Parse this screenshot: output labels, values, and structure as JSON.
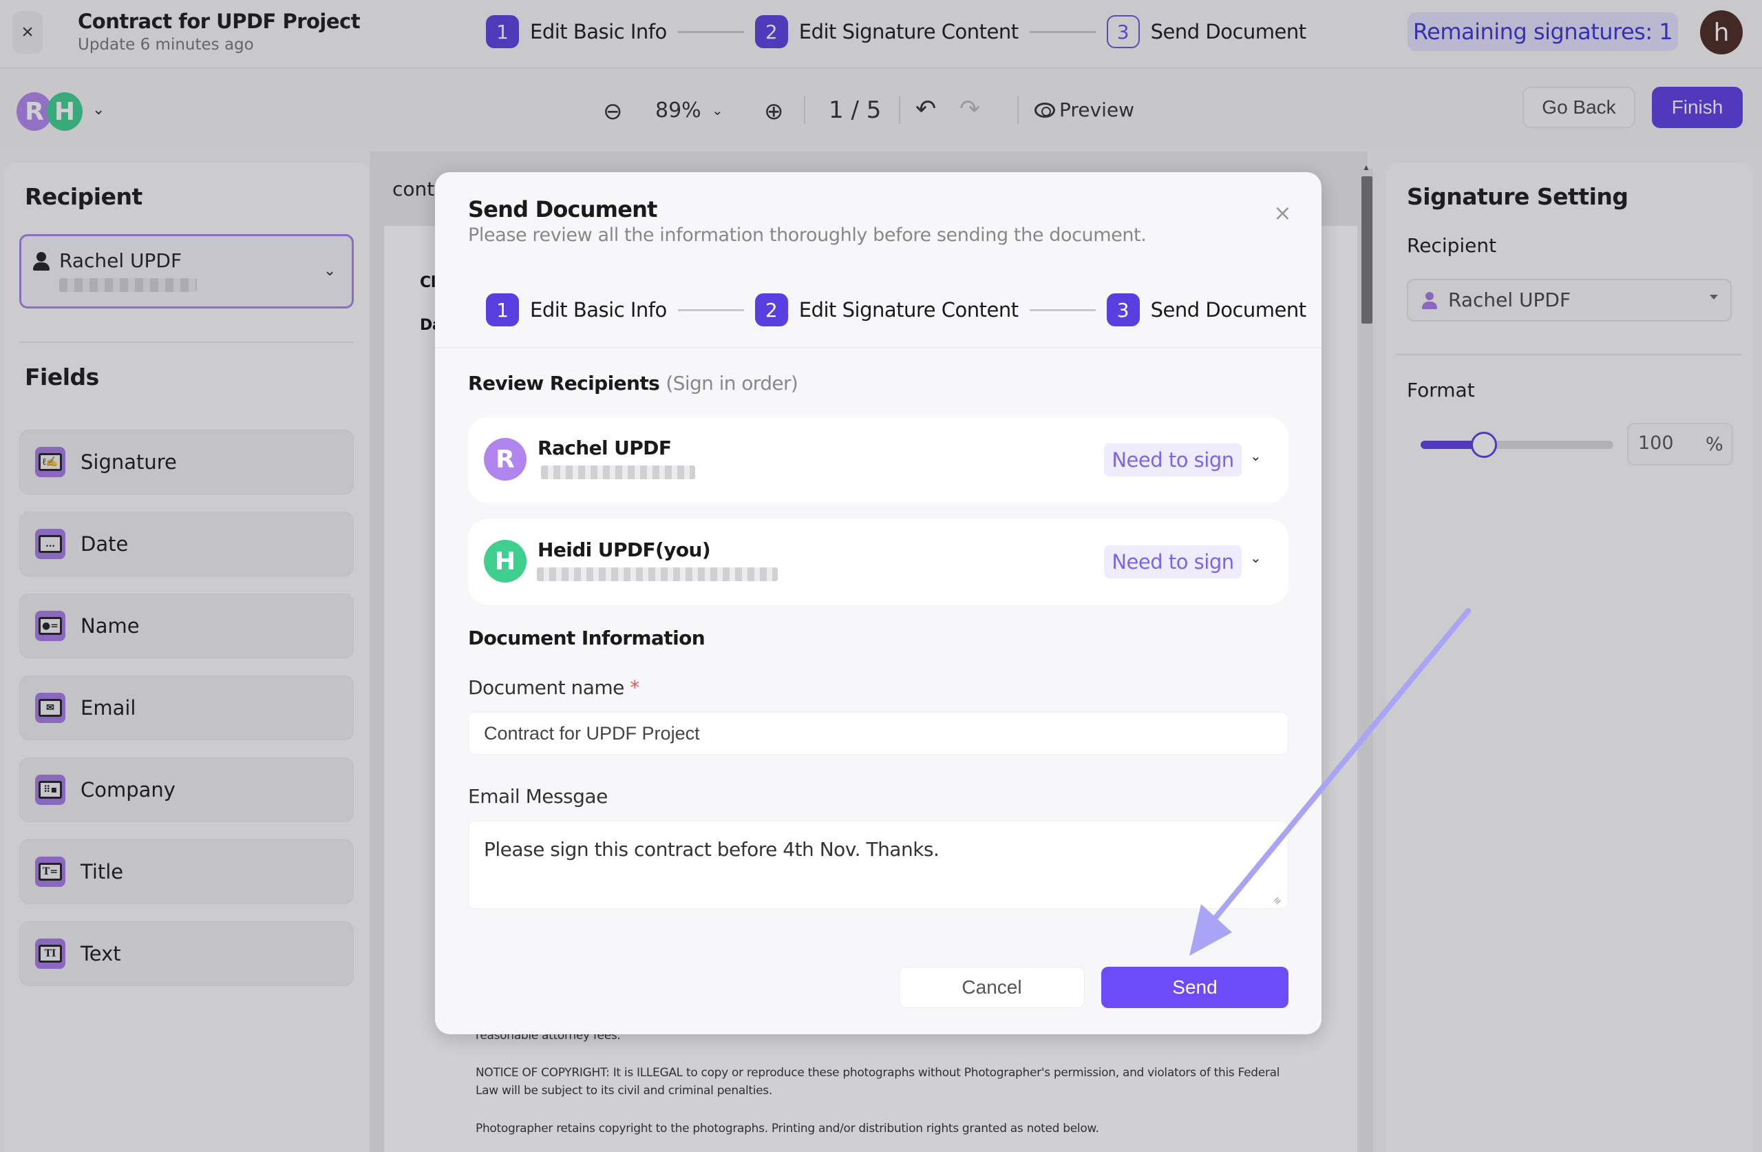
{
  "header": {
    "close_icon": "×",
    "title": "Contract for UPDF Project",
    "subtitle": "Update 6 minutes ago",
    "steps": [
      {
        "num": "1",
        "label": "Edit Basic Info",
        "state": "done"
      },
      {
        "num": "2",
        "label": "Edit Signature Content",
        "state": "done"
      },
      {
        "num": "3",
        "label": "Send Document",
        "state": "current"
      }
    ],
    "remaining_signatures": "Remaining signatures: 1",
    "user_initial": "h"
  },
  "toolbar": {
    "avatars": [
      "R",
      "H"
    ],
    "zoom_level": "89%",
    "page_indicator": "1 / 5",
    "preview_label": "Preview",
    "go_back_label": "Go Back",
    "finish_label": "Finish"
  },
  "left_panel": {
    "recipient_heading": "Recipient",
    "selected_recipient": "Rachel UPDF",
    "fields_heading": "Fields",
    "fields": [
      {
        "label": "Signature",
        "icon": "signature-icon"
      },
      {
        "label": "Date",
        "icon": "calendar-icon"
      },
      {
        "label": "Name",
        "icon": "id-card-icon"
      },
      {
        "label": "Email",
        "icon": "envelope-icon"
      },
      {
        "label": "Company",
        "icon": "building-icon"
      },
      {
        "label": "Title",
        "icon": "title-icon"
      },
      {
        "label": "Text",
        "icon": "text-icon"
      }
    ]
  },
  "document": {
    "name_label_partial": "contr",
    "visible_text": [
      "reasonable attorney fees.",
      "NOTICE OF COPYRIGHT: It is ILLEGAL to copy or reproduce these photographs without Photographer's permission, and violators of this Federal",
      "Law will be subject to its civil and criminal penalties.",
      "Photographer retains copyright to the photographs. Printing and/or distribution rights granted as noted below."
    ],
    "partial_headings": [
      "Cl",
      "Da"
    ]
  },
  "right_panel": {
    "heading": "Signature Setting",
    "recipient_label": "Recipient",
    "recipient_value": "Rachel UPDF",
    "format_label": "Format",
    "format_slider_fraction": 0.33,
    "format_value": "100",
    "format_unit": "%"
  },
  "modal": {
    "title": "Send Document",
    "subtitle": "Please review all the information thoroughly before sending the document.",
    "close_icon": "×",
    "steps": [
      {
        "num": "1",
        "label": "Edit Basic Info"
      },
      {
        "num": "2",
        "label": "Edit Signature Content"
      },
      {
        "num": "3",
        "label": "Send Document"
      }
    ],
    "review_heading": "Review Recipients",
    "review_note": "(Sign in order)",
    "recipients": [
      {
        "initial": "R",
        "name": "Rachel UPDF",
        "role": "Need to sign",
        "color": "#b085ee"
      },
      {
        "initial": "H",
        "name": "Heidi UPDF(you)",
        "role": "Need to sign",
        "color": "#3ecf8e"
      }
    ],
    "doc_info_heading": "Document Information",
    "doc_name_label": "Document name",
    "doc_name_required": "*",
    "doc_name_value": "Contract for UPDF Project",
    "email_message_label": "Email Messgae",
    "email_message_value": "Please sign this contract before 4th Nov. Thanks.",
    "cancel_label": "Cancel",
    "send_label": "Send"
  },
  "colors": {
    "accent": "#5b3ee4",
    "send_button": "#6c4cf8",
    "annotation_arrow": "#a9a4f5"
  }
}
